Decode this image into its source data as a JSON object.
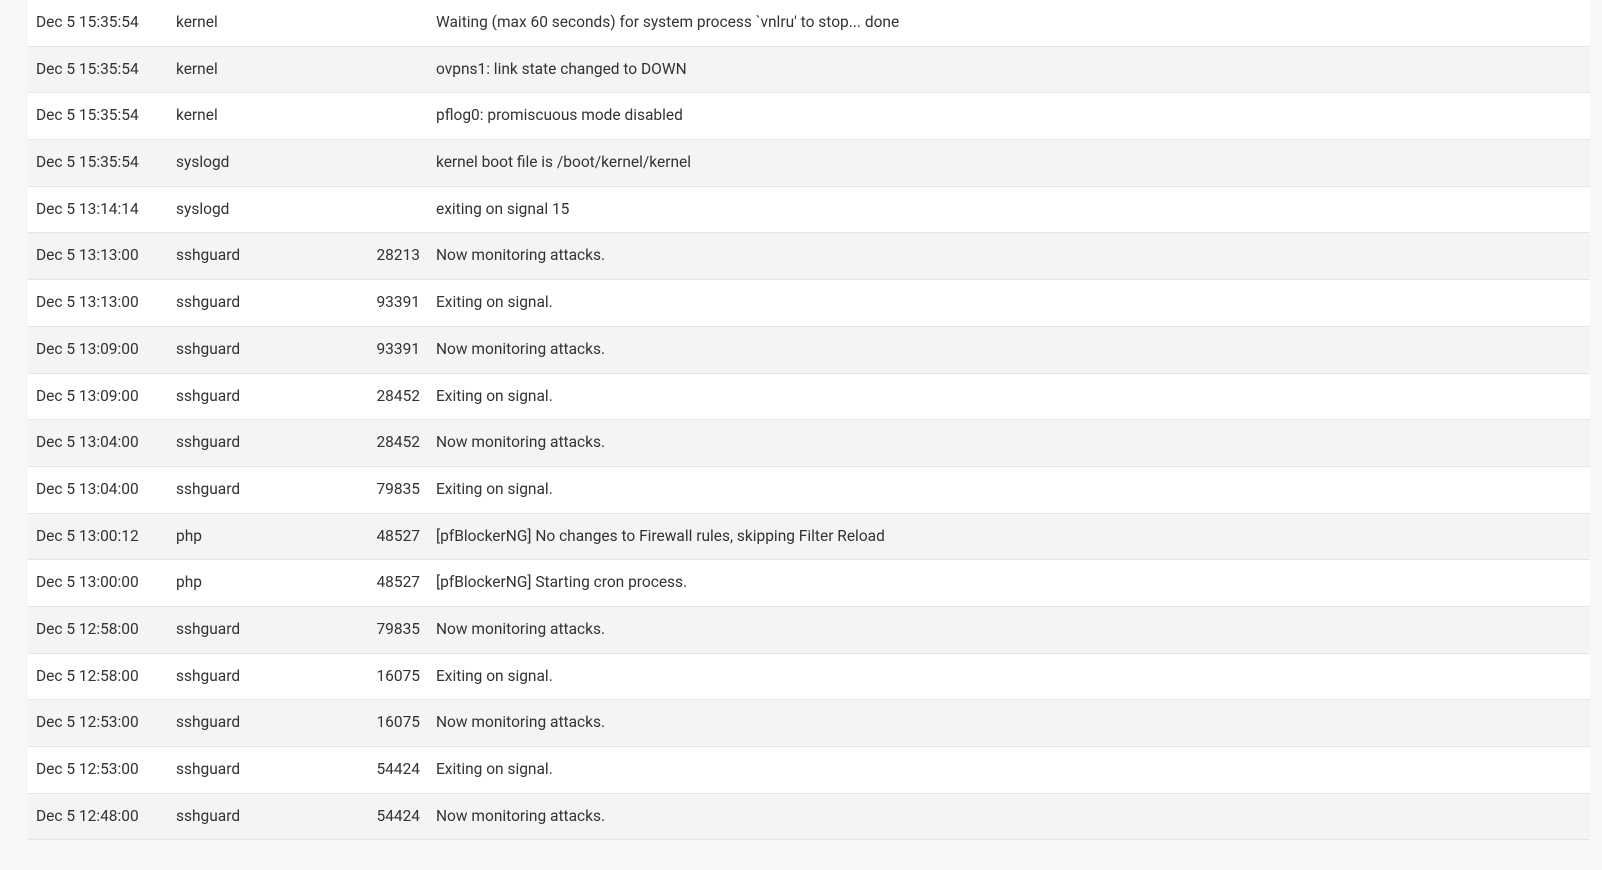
{
  "logs": [
    {
      "time": "Dec 5 15:35:54",
      "process": "kernel",
      "pid": "",
      "message": "Waiting (max 60 seconds) for system process `vnlru' to stop... done"
    },
    {
      "time": "Dec 5 15:35:54",
      "process": "kernel",
      "pid": "",
      "message": "ovpns1: link state changed to DOWN"
    },
    {
      "time": "Dec 5 15:35:54",
      "process": "kernel",
      "pid": "",
      "message": "pflog0: promiscuous mode disabled"
    },
    {
      "time": "Dec 5 15:35:54",
      "process": "syslogd",
      "pid": "",
      "message": "kernel boot file is /boot/kernel/kernel"
    },
    {
      "time": "Dec 5 13:14:14",
      "process": "syslogd",
      "pid": "",
      "message": "exiting on signal 15"
    },
    {
      "time": "Dec 5 13:13:00",
      "process": "sshguard",
      "pid": "28213",
      "message": "Now monitoring attacks."
    },
    {
      "time": "Dec 5 13:13:00",
      "process": "sshguard",
      "pid": "93391",
      "message": "Exiting on signal."
    },
    {
      "time": "Dec 5 13:09:00",
      "process": "sshguard",
      "pid": "93391",
      "message": "Now monitoring attacks."
    },
    {
      "time": "Dec 5 13:09:00",
      "process": "sshguard",
      "pid": "28452",
      "message": "Exiting on signal."
    },
    {
      "time": "Dec 5 13:04:00",
      "process": "sshguard",
      "pid": "28452",
      "message": "Now monitoring attacks."
    },
    {
      "time": "Dec 5 13:04:00",
      "process": "sshguard",
      "pid": "79835",
      "message": "Exiting on signal."
    },
    {
      "time": "Dec 5 13:00:12",
      "process": "php",
      "pid": "48527",
      "message": "[pfBlockerNG] No changes to Firewall rules, skipping Filter Reload"
    },
    {
      "time": "Dec 5 13:00:00",
      "process": "php",
      "pid": "48527",
      "message": "[pfBlockerNG] Starting cron process."
    },
    {
      "time": "Dec 5 12:58:00",
      "process": "sshguard",
      "pid": "79835",
      "message": "Now monitoring attacks."
    },
    {
      "time": "Dec 5 12:58:00",
      "process": "sshguard",
      "pid": "16075",
      "message": "Exiting on signal."
    },
    {
      "time": "Dec 5 12:53:00",
      "process": "sshguard",
      "pid": "16075",
      "message": "Now monitoring attacks."
    },
    {
      "time": "Dec 5 12:53:00",
      "process": "sshguard",
      "pid": "54424",
      "message": "Exiting on signal."
    },
    {
      "time": "Dec 5 12:48:00",
      "process": "sshguard",
      "pid": "54424",
      "message": "Now monitoring attacks."
    }
  ]
}
